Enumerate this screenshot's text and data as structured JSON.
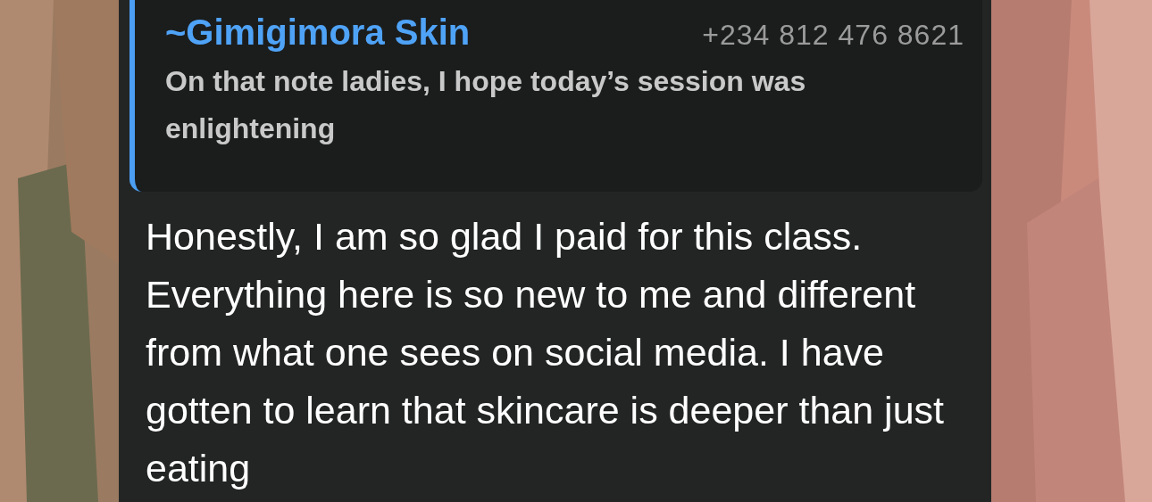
{
  "quoted_message": {
    "sender": "~Gimigimora Skin",
    "phone": "+234 812 476 8621",
    "text": "On that note ladies,  I hope today’s session was enlightening"
  },
  "message": {
    "text": "Honestly, I am so glad I paid for this class. Everything here is so new to me and different from what one sees on social media. I have gotten to learn that skincare is deeper than just eating"
  }
}
